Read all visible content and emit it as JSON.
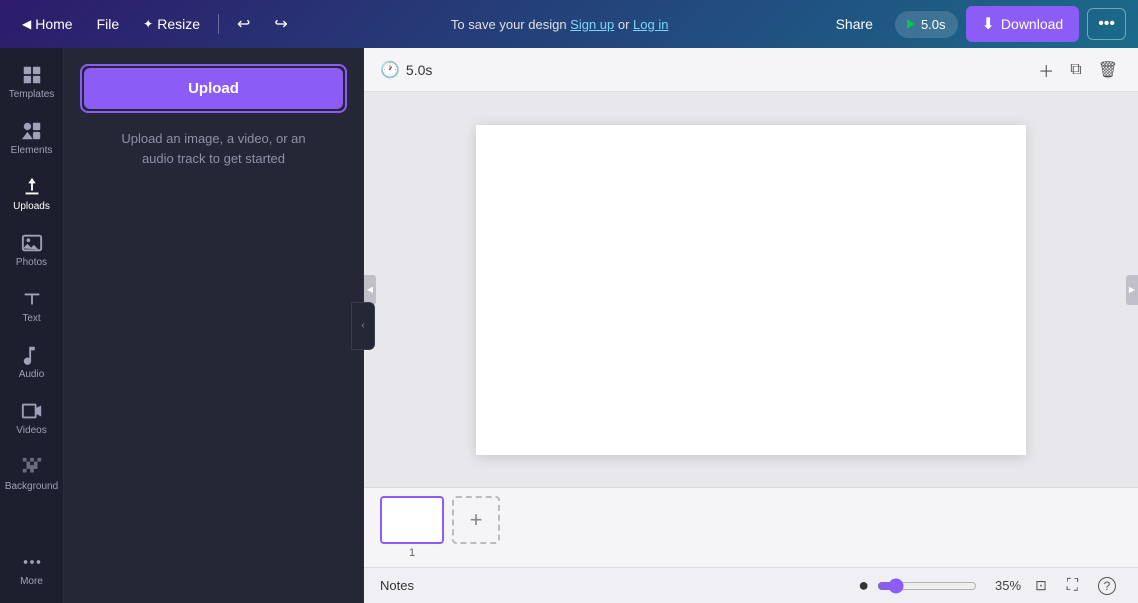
{
  "nav": {
    "home_label": "Home",
    "file_label": "File",
    "resize_label": "Resize",
    "undo_icon": "↩",
    "redo_icon": "↪",
    "center_text": "To save your design ",
    "signup_label": "Sign up",
    "or_label": " or ",
    "login_label": "Log in",
    "share_label": "Share",
    "play_duration": "5.0s",
    "download_label": "Download",
    "more_icon": "•••"
  },
  "sidebar": {
    "items": [
      {
        "id": "templates",
        "label": "Templates"
      },
      {
        "id": "elements",
        "label": "Elements"
      },
      {
        "id": "uploads",
        "label": "Uploads"
      },
      {
        "id": "photos",
        "label": "Photos"
      },
      {
        "id": "text",
        "label": "Text"
      },
      {
        "id": "audio",
        "label": "Audio"
      },
      {
        "id": "videos",
        "label": "Videos"
      },
      {
        "id": "background",
        "label": "Background"
      },
      {
        "id": "more",
        "label": "More"
      }
    ]
  },
  "uploads_panel": {
    "upload_button_label": "Upload",
    "hint_text": "Upload an image, a video, or an\naudio track to get started",
    "collapse_icon": "‹"
  },
  "canvas_toolbar": {
    "timer": "5.0s",
    "add_icon": "+",
    "copy_icon": "⧉",
    "delete_icon": "🗑"
  },
  "pages": [
    {
      "num": "1",
      "active": true
    }
  ],
  "add_page_icon": "+",
  "footer": {
    "notes_label": "Notes",
    "zoom_value": 35,
    "zoom_label": "35%",
    "fit_icon": "⊡",
    "fullscreen_icon": "⛶",
    "help_icon": "?"
  },
  "colors": {
    "purple_accent": "#8b5cf6",
    "nav_gradient_start": "#2d1b6b",
    "nav_gradient_end": "#1a6b8a"
  }
}
